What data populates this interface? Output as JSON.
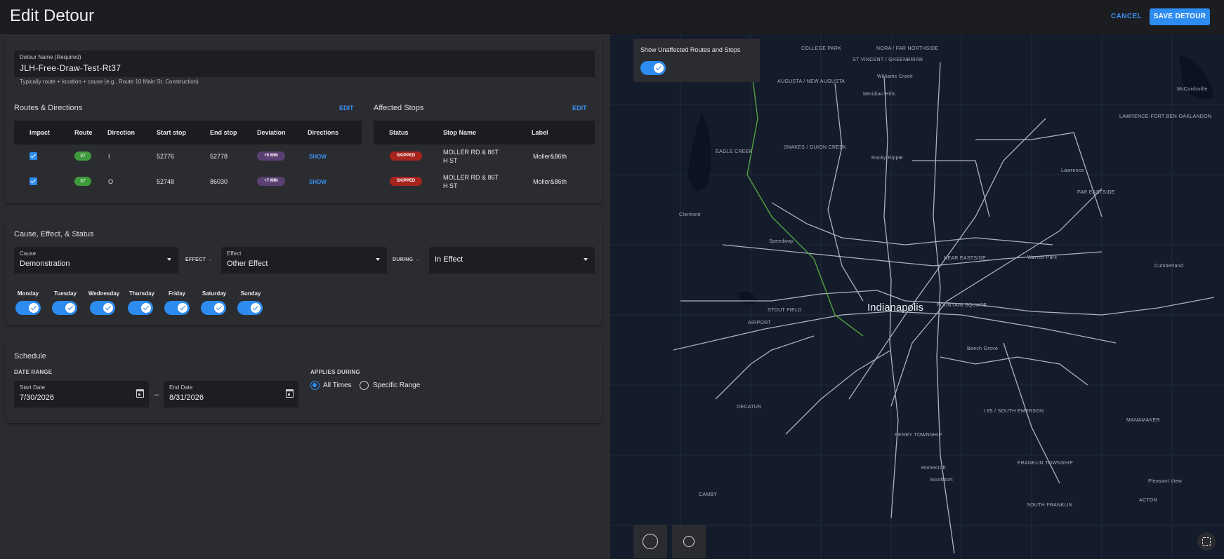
{
  "header": {
    "title": "Edit Detour",
    "cancel_label": "CANCEL",
    "save_label": "SAVE DETOUR"
  },
  "detour_name": {
    "label": "Detour Name (Required)",
    "value": "JLH-Free-Draw-Test-Rt37",
    "help": "Typically route + location + cause (e.g., Route 10 Main St. Construction)"
  },
  "routes": {
    "title": "Routes & Directions",
    "edit_label": "EDIT",
    "columns": [
      "Impact",
      "Route",
      "Direction",
      "Start stop",
      "End stop",
      "Deviation",
      "Directions"
    ],
    "rows": [
      {
        "impact": true,
        "route": "37",
        "direction": "I",
        "start": "52776",
        "end": "52778",
        "deviation": "+5 MIN",
        "directions": "SHOW"
      },
      {
        "impact": true,
        "route": "37",
        "direction": "O",
        "start": "52748",
        "end": "86030",
        "deviation": "+7 MIN",
        "directions": "SHOW"
      }
    ]
  },
  "stops": {
    "title": "Affected Stops",
    "edit_label": "EDIT",
    "columns": [
      "Status",
      "Stop Name",
      "Label"
    ],
    "rows": [
      {
        "status": "SKIPPED",
        "name_line1": "MOLLER RD & 86T",
        "name_line2": "H ST",
        "label": "Moller&86th"
      },
      {
        "status": "SKIPPED",
        "name_line1": "MOLLER RD & 86T",
        "name_line2": "H ST",
        "label": "Moller&86th"
      }
    ]
  },
  "cause_effect": {
    "title": "Cause, Effect, & Status",
    "cause_label": "Cause",
    "cause_value": "Demonstration",
    "effect_between": "EFFECT →",
    "effect_label": "Effect",
    "effect_value": "Other Effect",
    "during_between": "DURING →",
    "status_value": "In Effect"
  },
  "days": [
    {
      "label": "Monday",
      "on": true
    },
    {
      "label": "Tuesday",
      "on": true
    },
    {
      "label": "Wednesday",
      "on": true
    },
    {
      "label": "Thursday",
      "on": true
    },
    {
      "label": "Friday",
      "on": true
    },
    {
      "label": "Saturday",
      "on": true
    },
    {
      "label": "Sunday",
      "on": true
    }
  ],
  "schedule": {
    "title": "Schedule",
    "date_range_label": "DATE RANGE",
    "start_label": "Start Date",
    "start_value": "7/30/2026",
    "end_label": "End Date",
    "end_value": "8/31/2026",
    "dash": "–",
    "applies_label": "APPLIES DURING",
    "option_all": "All Times",
    "option_specific": "Specific Range",
    "selected": "All Times"
  },
  "map": {
    "overlay_label": "Show Unaffected Routes and Stops",
    "overlay_on": true,
    "city": "Indianapolis",
    "labels": [
      "COLLEGE PARK",
      "NORA / FAR NORTHSIDE",
      "ST VINCENT / GREENBRIAR",
      "AUGUSTA / NEW AUGUSTA",
      "Williams Creek",
      "Meridian Hills",
      "McCordsville",
      "LAWRENCE-FORT BEN-OAKLANDON",
      "SNAKES / GUION CREEK",
      "EAGLE CREEK",
      "Rocky Ripple",
      "Lawrence",
      "FAR EASTSIDE",
      "Clermont",
      "Speedway",
      "NEAR EASTSIDE",
      "Warren Park",
      "Cumberland",
      "STOUT FIELD",
      "AIRPORT",
      "FOUNTAIN SQUARE",
      "Beech Grove",
      "DECATUR",
      "PERRY TOWNSHIP",
      "I 65 / SOUTH EMERSON",
      "Homecroft",
      "Southport",
      "FRANKLIN TOWNSHIP",
      "CAMBY",
      "Pleasant View",
      "ACTON",
      "SOUTH FRANKLIN",
      "MANAMAKER"
    ]
  },
  "colors": {
    "accent": "#2d8cf0",
    "route_green": "#3e9a3d",
    "skipped_red": "#a6231e",
    "deviation_purple": "#5a3f72",
    "map_bg": "#141c2b"
  }
}
